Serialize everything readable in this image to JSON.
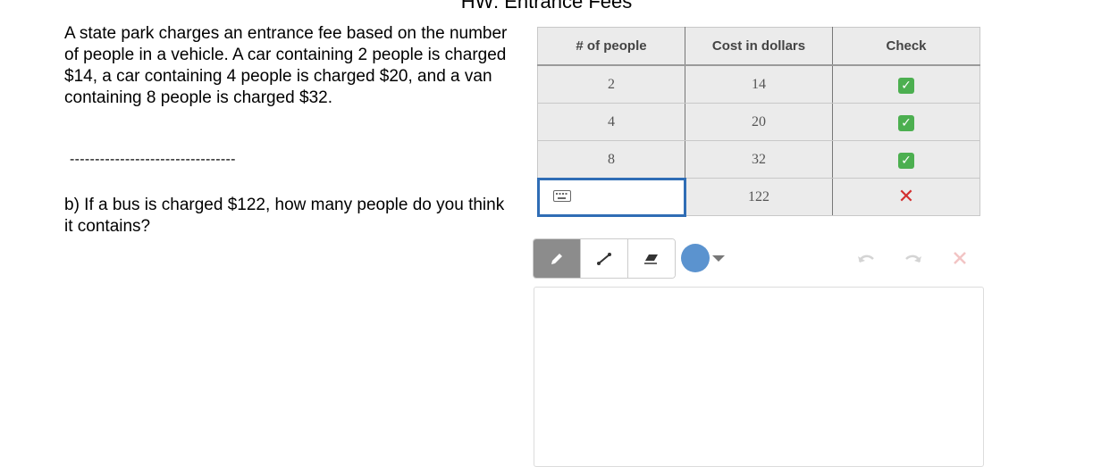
{
  "page": {
    "title": "HW: Entrance Fees"
  },
  "prompt": {
    "text": "A state park charges an entrance fee based on the number of people in a vehicle. A car containing 2 people is charged $14, a car containing 4 people is charged $20, and a van containing 8 people is charged $32.",
    "divider": "---------------------------------",
    "question": "b) If a bus is charged $122, how many people do you think it contains?"
  },
  "table": {
    "headers": [
      "# of people",
      "Cost in dollars",
      "Check"
    ],
    "rows": [
      {
        "people": "2",
        "cost": "14",
        "check": "correct"
      },
      {
        "people": "4",
        "cost": "20",
        "check": "correct"
      },
      {
        "people": "8",
        "cost": "32",
        "check": "correct"
      },
      {
        "people": "",
        "cost": "122",
        "check": "incorrect"
      }
    ],
    "check_glyphs": {
      "correct": "✓",
      "incorrect": "✕"
    }
  },
  "sketch_toolbar": {
    "tools": [
      "pencil-icon",
      "line-icon",
      "eraser-icon"
    ],
    "active_tool": "pencil-icon",
    "pen_color": "#5b93cf",
    "actions": [
      "undo-icon",
      "redo-icon",
      "clear-icon"
    ]
  },
  "colors": {
    "input_focus": "#2f6db5",
    "correct": "#4caf50",
    "incorrect": "#d32f2f"
  }
}
